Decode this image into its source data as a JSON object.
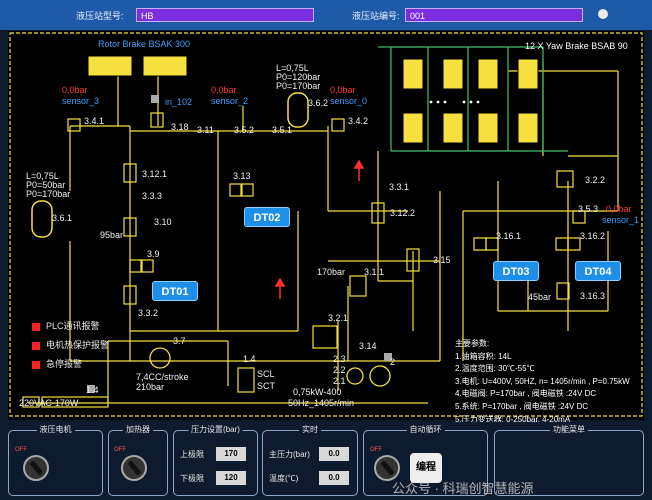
{
  "header": {
    "station_name_label": "液压站型号:",
    "station_name_value": "HB",
    "station_id_label": "液压站编号:",
    "station_id_value": "001"
  },
  "diagram": {
    "rotor_brake_title": "Rotor Brake BSAK 300",
    "yaw_brake_title": "12 X Yaw Brake BSAB 90",
    "dt_labels": [
      "DT01",
      "DT02",
      "DT03",
      "DT04"
    ],
    "sensors": [
      {
        "value": "0,0bar",
        "name": "sensor_3"
      },
      {
        "value": "0,0bar",
        "name": "sensor_2"
      },
      {
        "value": "0,0bar",
        "name": "sensor_0"
      },
      {
        "value": "0,0bar",
        "name": "sensor_1"
      }
    ],
    "accumulators": [
      {
        "l": "L=0,75L",
        "p0": "P0=120bar",
        "p": "P0=170bar"
      },
      {
        "l": "L=0,75L",
        "p0": "P0=50bar",
        "p": "P0=170bar"
      }
    ],
    "component_labels": {
      "c341": "3.4.1",
      "c318": "3.18",
      "c311": "3.11",
      "c352": "3.5.2",
      "c351": "3.5.1",
      "c362": "3.6.2",
      "c342": "3.4.2",
      "in102": "in_102",
      "c3121": "3.12.1",
      "c333": "3.3.3",
      "c310": "3.10",
      "c39": "3.9",
      "c313": "3.13",
      "c361": "3.6.1",
      "c331": "3.3.1",
      "c3122": "3.12.2",
      "c315": "3.15",
      "c311b": "3.1.1",
      "c332": "3.3.2",
      "c322": "3.2.2",
      "c353": "3.5.3",
      "c3161": "3.16.1",
      "c3162": "3.16.2",
      "c3163": "3.16.3",
      "c321": "3.2.1",
      "c314": "3.14",
      "c37": "3.7",
      "c14a": "1.4",
      "c14b": "1.4",
      "c23": "2.3",
      "c22": "2.2",
      "c21": "2.1",
      "c2": "2"
    },
    "bar95": "95bar",
    "bar170": "170bar",
    "bar45": "45bar",
    "pump_spec_1": "7,4CC/stroke",
    "pump_spec_2": "210bar",
    "motor_spec_1": "0,75kW-400",
    "motor_spec_2": "50Hz_1405r/min",
    "power_label": "220VAC-170W",
    "scl": "SCL",
    "sct": "SCT"
  },
  "alarms": [
    {
      "label": "PLC通讯报警"
    },
    {
      "label": "电机热保护报警"
    },
    {
      "label": "急停报警"
    }
  ],
  "params": {
    "title": "主要参数:",
    "lines": [
      "1.油箱容积: 14L",
      "2.温度范围: 30℃-55℃",
      "3.电机: U=400V, 50HZ, n= 1405r/min , P=0.75kW",
      "4.电磁阀: P=170bar , 阀电磁铁 :24V DC",
      "5.系统: P=170bar , 阀电磁铁 :24V DC",
      "5.压力变送器: 0-250bar, 4-20mA"
    ]
  },
  "bottom": {
    "panel_titles": [
      "液压电机",
      "加热器",
      "压力设置(bar)",
      "实时",
      "自动循环",
      "功能菜单"
    ],
    "off_label": "OFF",
    "upper_limit_label": "上极限",
    "upper_limit_value": "170",
    "lower_limit_label": "下极限",
    "lower_limit_value": "120",
    "pressure_label": "主压力(bar)",
    "pressure_value": "0.0",
    "temp_label": "温度(℃)",
    "temp_value": "0.0",
    "edit_button": "编程",
    "watermark": "公众号 · 科瑞创智慧能源"
  },
  "colors": {
    "header_bg": "#1f5aa8",
    "field_bg": "#7a2ee0",
    "diagram_line": "#f5e040",
    "diagram_line_alt": "#3cc070",
    "dt_box": "#1e8fe8",
    "alarm_red": "#ff2020"
  }
}
